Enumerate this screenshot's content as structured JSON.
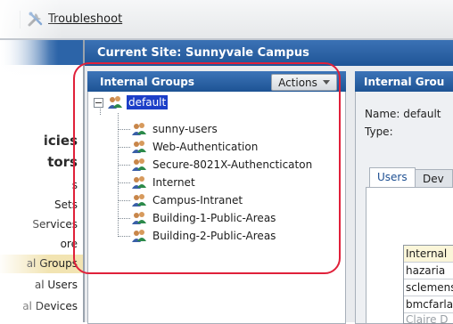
{
  "toolbar": {
    "troubleshoot_label": "Troubleshoot"
  },
  "sidebar": {
    "headings": [
      "icies",
      "tors"
    ],
    "items": [
      {
        "label": "s",
        "selected": false
      },
      {
        "label": "Sets",
        "selected": false
      },
      {
        "label": "Services",
        "selected": false
      },
      {
        "label": "ore",
        "selected": false
      },
      {
        "label": "al Groups",
        "selected": true
      },
      {
        "label": "al Users",
        "selected": false
      },
      {
        "label": "al Devices",
        "selected": false
      }
    ]
  },
  "site": {
    "title": "Current Site:  Sunnyvale Campus"
  },
  "internal_groups": {
    "title": "Internal Groups",
    "actions_label": "Actions",
    "tree": {
      "root": "default",
      "children": [
        "sunny-users",
        "Web-Authentication",
        "Secure-8021X-Authencticaton",
        "Internet",
        "Campus-Intranet",
        "Building-1-Public-Areas",
        "Building-2-Public-Areas"
      ]
    }
  },
  "details": {
    "title": "Internal Grou",
    "name_label": "Name: default",
    "type_label": "Type:",
    "tabs": [
      {
        "label": "Users",
        "active": true
      },
      {
        "label": "Dev",
        "active": false
      }
    ],
    "users_table": {
      "header": "Internal",
      "rows": [
        "hazaria",
        "sclemens",
        "bmcfarla",
        "Claire D"
      ]
    }
  },
  "colors": {
    "accent_blue": "#1f5596",
    "selection": "#1c3fc8",
    "annotation_red": "#e0203a",
    "sidebar_selected": "#f2e4b2"
  }
}
